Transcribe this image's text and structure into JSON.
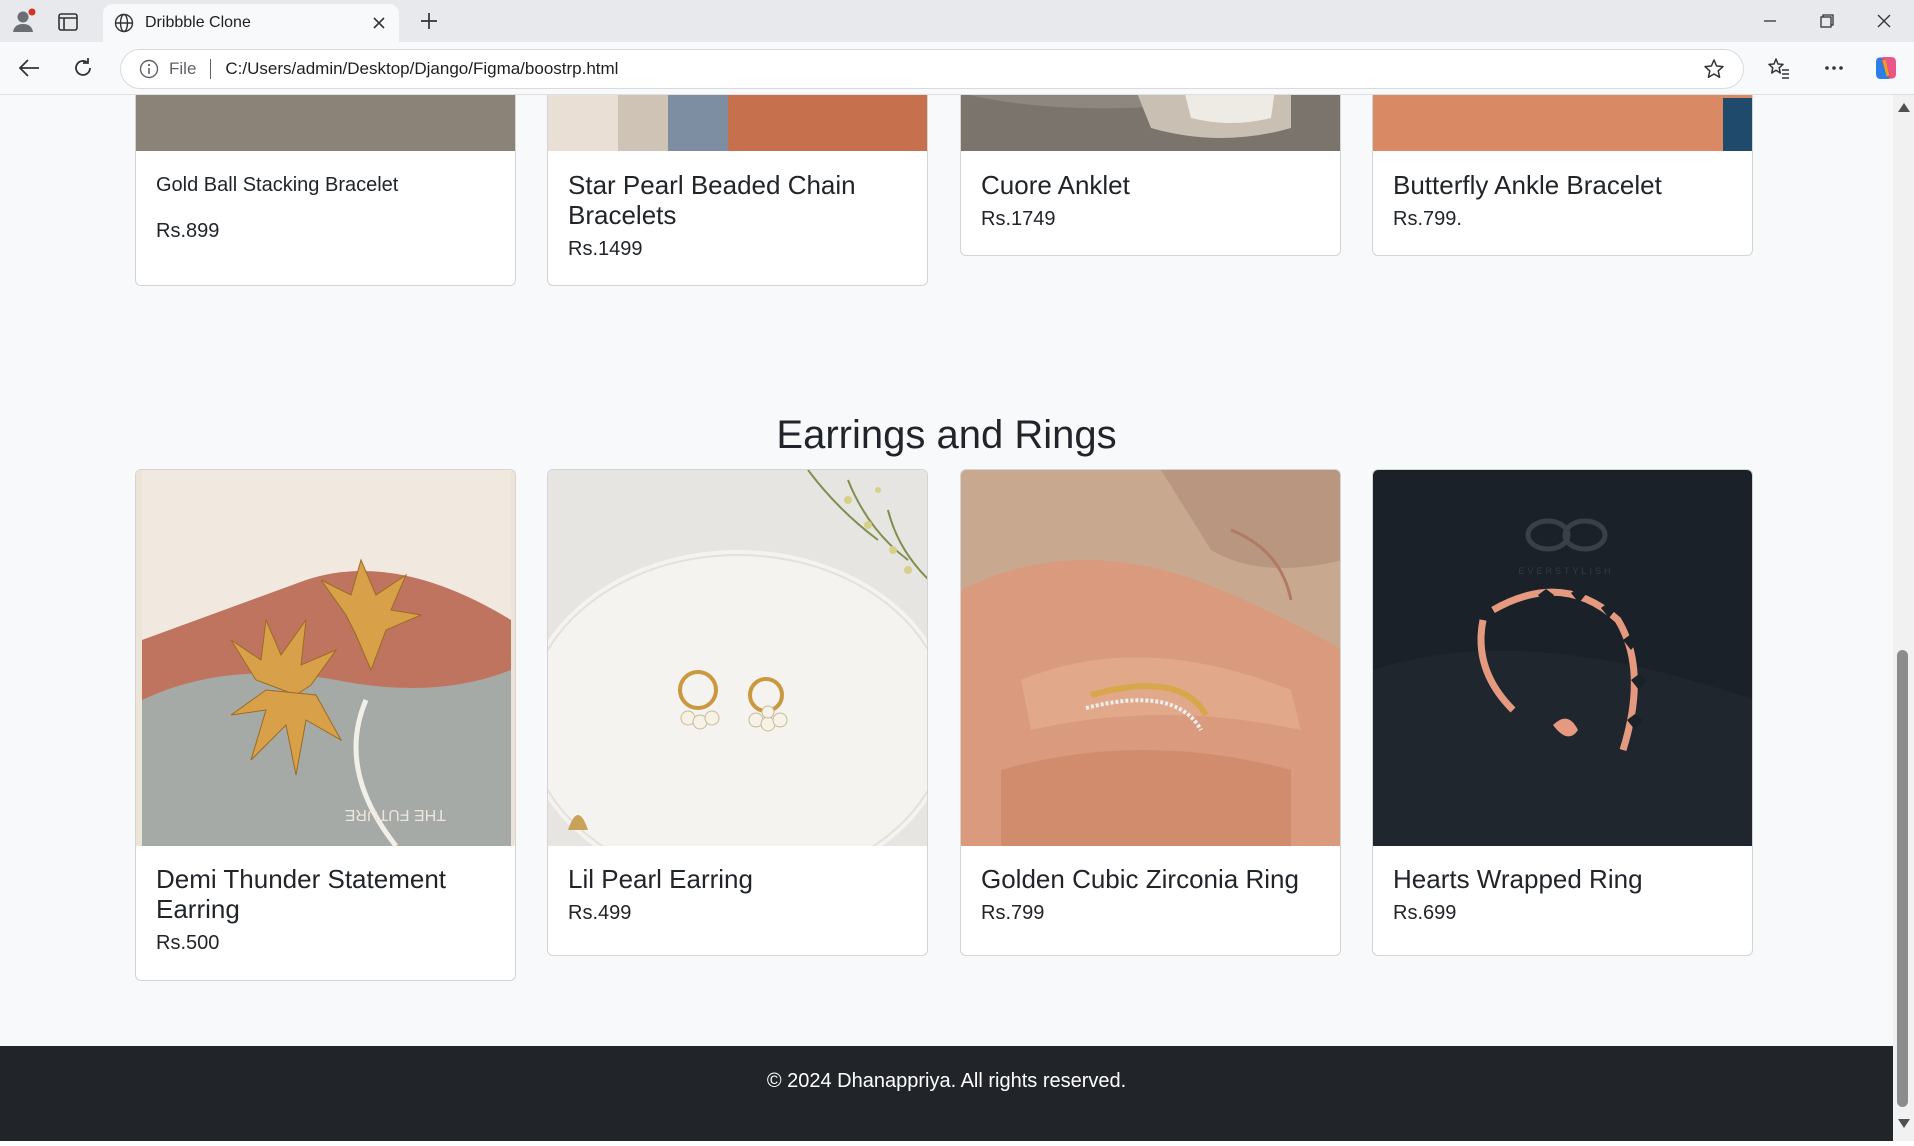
{
  "browser": {
    "tab_title": "Dribbble Clone",
    "file_label": "File",
    "url": "C:/Users/admin/Desktop/Django/Figma/boostrp.html"
  },
  "top_products": [
    {
      "name": "Gold Ball Stacking Bracelet",
      "price": "Rs.899"
    },
    {
      "name": "Star Pearl Beaded Chain Bracelets",
      "price": "Rs.1499"
    },
    {
      "name": "Cuore Anklet",
      "price": "Rs.1749"
    },
    {
      "name": "Butterfly Ankle Bracelet",
      "price": "Rs.799."
    }
  ],
  "section": {
    "title": "Earrings and Rings",
    "products": [
      {
        "name": "Demi Thunder Statement Earring",
        "price": "Rs.500"
      },
      {
        "name": "Lil Pearl Earring",
        "price": "Rs.499"
      },
      {
        "name": "Golden Cubic Zirconia Ring",
        "price": "Rs.799"
      },
      {
        "name": "Hearts Wrapped Ring",
        "price": "Rs.699"
      }
    ]
  },
  "product_image_text": {
    "card_print": "THE FUTURE",
    "ring_brand": "EVERSTYLISH"
  },
  "footer": {
    "text": "© 2024 Dhanappriya. All rights reserved."
  }
}
